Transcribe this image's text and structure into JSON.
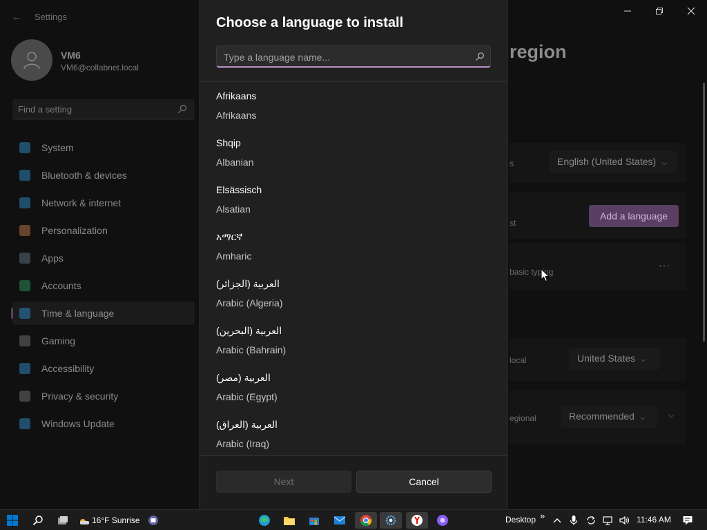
{
  "settings": {
    "app_title": "Settings",
    "user": {
      "name": "VM6",
      "email": "VM6@collabnet.local"
    },
    "find_placeholder": "Find a setting",
    "nav": [
      {
        "label": "System",
        "icon": "monitor-icon",
        "color": "#2c7fb8"
      },
      {
        "label": "Bluetooth & devices",
        "icon": "bluetooth-icon",
        "color": "#2c7fb8"
      },
      {
        "label": "Network & internet",
        "icon": "wifi-icon",
        "color": "#2c7fb8"
      },
      {
        "label": "Personalization",
        "icon": "brush-icon",
        "color": "#b07040"
      },
      {
        "label": "Apps",
        "icon": "apps-icon",
        "color": "#5a6a7a"
      },
      {
        "label": "Accounts",
        "icon": "person-icon",
        "color": "#2a8a5a"
      },
      {
        "label": "Time & language",
        "icon": "globe-clock-icon",
        "color": "#2c7fb8"
      },
      {
        "label": "Gaming",
        "icon": "controller-icon",
        "color": "#6a6a6a"
      },
      {
        "label": "Accessibility",
        "icon": "accessibility-icon",
        "color": "#2c7fb8"
      },
      {
        "label": "Privacy & security",
        "icon": "shield-icon",
        "color": "#6a6a6a"
      },
      {
        "label": "Windows Update",
        "icon": "update-icon",
        "color": "#2c7fb8"
      }
    ],
    "active_nav_index": 6,
    "page_title_partial": "region",
    "background": {
      "row1_text": "s",
      "display_language": "English (United States)",
      "row2_text": "st",
      "add_language_label": "Add a language",
      "row3_text": "basic typing",
      "more_label": "···",
      "row4_text": "local",
      "country": "United States",
      "row5_text": "egional",
      "regional_format": "Recommended"
    }
  },
  "dialog": {
    "title": "Choose a language to install",
    "search_placeholder": "Type a language name...",
    "languages": [
      {
        "native": "Afrikaans",
        "english": "Afrikaans"
      },
      {
        "native": "Shqip",
        "english": "Albanian"
      },
      {
        "native": "Elsässisch",
        "english": "Alsatian"
      },
      {
        "native": "አማርኛ",
        "english": "Amharic"
      },
      {
        "native": "العربية (الجزائر)",
        "english": "Arabic (Algeria)"
      },
      {
        "native": "العربية (البحرين)",
        "english": "Arabic (Bahrain)"
      },
      {
        "native": "العربية (مصر)",
        "english": "Arabic (Egypt)"
      },
      {
        "native": "العربية (العراق)",
        "english": "Arabic (Iraq)"
      }
    ],
    "next_label": "Next",
    "cancel_label": "Cancel"
  },
  "taskbar": {
    "weather": "16°F Sunrise",
    "desktop_label": "Desktop",
    "overflow_label": "»",
    "time": "11:46 AM",
    "accent_color": "#0078d4"
  }
}
